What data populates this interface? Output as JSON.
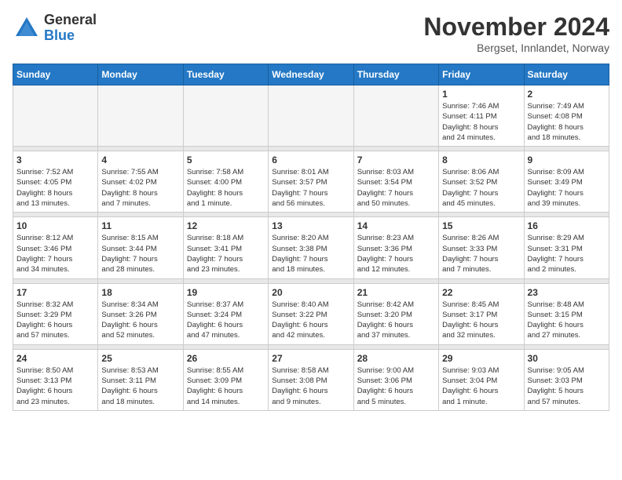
{
  "logo": {
    "general": "General",
    "blue": "Blue"
  },
  "title": "November 2024",
  "location": "Bergset, Innlandet, Norway",
  "days_of_week": [
    "Sunday",
    "Monday",
    "Tuesday",
    "Wednesday",
    "Thursday",
    "Friday",
    "Saturday"
  ],
  "weeks": [
    [
      {
        "day": "",
        "info": ""
      },
      {
        "day": "",
        "info": ""
      },
      {
        "day": "",
        "info": ""
      },
      {
        "day": "",
        "info": ""
      },
      {
        "day": "",
        "info": ""
      },
      {
        "day": "1",
        "info": "Sunrise: 7:46 AM\nSunset: 4:11 PM\nDaylight: 8 hours\nand 24 minutes."
      },
      {
        "day": "2",
        "info": "Sunrise: 7:49 AM\nSunset: 4:08 PM\nDaylight: 8 hours\nand 18 minutes."
      }
    ],
    [
      {
        "day": "3",
        "info": "Sunrise: 7:52 AM\nSunset: 4:05 PM\nDaylight: 8 hours\nand 13 minutes."
      },
      {
        "day": "4",
        "info": "Sunrise: 7:55 AM\nSunset: 4:02 PM\nDaylight: 8 hours\nand 7 minutes."
      },
      {
        "day": "5",
        "info": "Sunrise: 7:58 AM\nSunset: 4:00 PM\nDaylight: 8 hours\nand 1 minute."
      },
      {
        "day": "6",
        "info": "Sunrise: 8:01 AM\nSunset: 3:57 PM\nDaylight: 7 hours\nand 56 minutes."
      },
      {
        "day": "7",
        "info": "Sunrise: 8:03 AM\nSunset: 3:54 PM\nDaylight: 7 hours\nand 50 minutes."
      },
      {
        "day": "8",
        "info": "Sunrise: 8:06 AM\nSunset: 3:52 PM\nDaylight: 7 hours\nand 45 minutes."
      },
      {
        "day": "9",
        "info": "Sunrise: 8:09 AM\nSunset: 3:49 PM\nDaylight: 7 hours\nand 39 minutes."
      }
    ],
    [
      {
        "day": "10",
        "info": "Sunrise: 8:12 AM\nSunset: 3:46 PM\nDaylight: 7 hours\nand 34 minutes."
      },
      {
        "day": "11",
        "info": "Sunrise: 8:15 AM\nSunset: 3:44 PM\nDaylight: 7 hours\nand 28 minutes."
      },
      {
        "day": "12",
        "info": "Sunrise: 8:18 AM\nSunset: 3:41 PM\nDaylight: 7 hours\nand 23 minutes."
      },
      {
        "day": "13",
        "info": "Sunrise: 8:20 AM\nSunset: 3:38 PM\nDaylight: 7 hours\nand 18 minutes."
      },
      {
        "day": "14",
        "info": "Sunrise: 8:23 AM\nSunset: 3:36 PM\nDaylight: 7 hours\nand 12 minutes."
      },
      {
        "day": "15",
        "info": "Sunrise: 8:26 AM\nSunset: 3:33 PM\nDaylight: 7 hours\nand 7 minutes."
      },
      {
        "day": "16",
        "info": "Sunrise: 8:29 AM\nSunset: 3:31 PM\nDaylight: 7 hours\nand 2 minutes."
      }
    ],
    [
      {
        "day": "17",
        "info": "Sunrise: 8:32 AM\nSunset: 3:29 PM\nDaylight: 6 hours\nand 57 minutes."
      },
      {
        "day": "18",
        "info": "Sunrise: 8:34 AM\nSunset: 3:26 PM\nDaylight: 6 hours\nand 52 minutes."
      },
      {
        "day": "19",
        "info": "Sunrise: 8:37 AM\nSunset: 3:24 PM\nDaylight: 6 hours\nand 47 minutes."
      },
      {
        "day": "20",
        "info": "Sunrise: 8:40 AM\nSunset: 3:22 PM\nDaylight: 6 hours\nand 42 minutes."
      },
      {
        "day": "21",
        "info": "Sunrise: 8:42 AM\nSunset: 3:20 PM\nDaylight: 6 hours\nand 37 minutes."
      },
      {
        "day": "22",
        "info": "Sunrise: 8:45 AM\nSunset: 3:17 PM\nDaylight: 6 hours\nand 32 minutes."
      },
      {
        "day": "23",
        "info": "Sunrise: 8:48 AM\nSunset: 3:15 PM\nDaylight: 6 hours\nand 27 minutes."
      }
    ],
    [
      {
        "day": "24",
        "info": "Sunrise: 8:50 AM\nSunset: 3:13 PM\nDaylight: 6 hours\nand 23 minutes."
      },
      {
        "day": "25",
        "info": "Sunrise: 8:53 AM\nSunset: 3:11 PM\nDaylight: 6 hours\nand 18 minutes."
      },
      {
        "day": "26",
        "info": "Sunrise: 8:55 AM\nSunset: 3:09 PM\nDaylight: 6 hours\nand 14 minutes."
      },
      {
        "day": "27",
        "info": "Sunrise: 8:58 AM\nSunset: 3:08 PM\nDaylight: 6 hours\nand 9 minutes."
      },
      {
        "day": "28",
        "info": "Sunrise: 9:00 AM\nSunset: 3:06 PM\nDaylight: 6 hours\nand 5 minutes."
      },
      {
        "day": "29",
        "info": "Sunrise: 9:03 AM\nSunset: 3:04 PM\nDaylight: 6 hours\nand 1 minute."
      },
      {
        "day": "30",
        "info": "Sunrise: 9:05 AM\nSunset: 3:03 PM\nDaylight: 5 hours\nand 57 minutes."
      }
    ]
  ]
}
